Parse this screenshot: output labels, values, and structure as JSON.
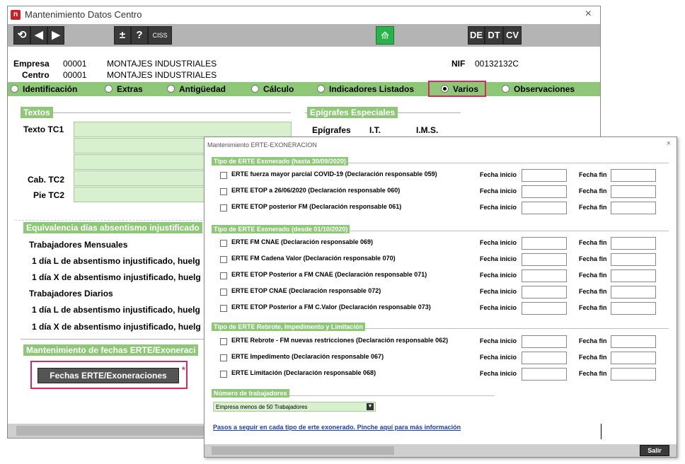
{
  "main_window": {
    "title": "Mantenimiento Datos Centro",
    "toolbar": {
      "refresh_glyph": "⟲",
      "prev_glyph": "◀",
      "next_glyph": "▶",
      "plusminus_label": "±",
      "help_label": "?",
      "ciss_label": "CISS",
      "cloud_glyph": "⟰",
      "de_label": "DE",
      "dt_label": "DT",
      "cv_label": "CV"
    },
    "empresa_label": "Empresa",
    "empresa_code": "00001",
    "empresa_name": "MONTAJES INDUSTRIALES",
    "centro_label": "Centro",
    "centro_code": "00001",
    "centro_name": "MONTAJES INDUSTRIALES",
    "nif_label": "NIF",
    "nif_value": "00132132C",
    "tabs": [
      "Identificación",
      "Extras",
      "Antigüedad",
      "Cálculo",
      "Indicadores Listados",
      "Varios",
      "Observaciones"
    ],
    "selected_tab": "Varios",
    "textos_title": "Textos",
    "texto_tc1_label": "Texto TC1",
    "cab_tc2_label": "Cab. TC2",
    "pie_tc2_label": "Pie TC2",
    "epigrafes_title": "Epígrafes Especiales",
    "epigrafes_label": "Epígrafes",
    "it_label": "I.T.",
    "ims_label": "I.M.S.",
    "equivalencia_title": "Equivalencia días absentismo injustificado",
    "trab_mensuales": "Trabajadores Mensuales",
    "mensual_l": "1 día L de absentismo injustificado, huelg",
    "mensual_x": "1 día X de absentismo injustificado, huelg",
    "trab_diarios": "Trabajadores Diarios",
    "diario_l": "1 día L de absentismo injustificado, huelg",
    "diario_x": "1 día X de absentismo injustificado, huelg",
    "erte_section_title": "Mantenimiento de fechas ERTE/Exoneraci",
    "fechas_button": "Fechas ERTE/Exoneraciones",
    "asterisk": "*"
  },
  "dialog": {
    "title": "Mantenimiento ERTE-EXONERACION",
    "close_glyph": "×",
    "fecha_inicio_label": "Fecha inicio",
    "fecha_fin_label": "Fecha fin",
    "sections": [
      {
        "title": "Tipo de ERTE Exonerado (hasta 30/09/2020)",
        "items": [
          "ERTE fuerza mayor parcial COVID-19 (Declaración responsable 059)",
          "ERTE ETOP a 26/06/2020 (Declaración responsable 060)",
          "ERTE ETOP posterior FM (Declaración responsable 061)"
        ]
      },
      {
        "title": "Tipo de ERTE Exonerado (desde 01/10/2020)",
        "items": [
          "ERTE FM CNAE (Declaración responsable 069)",
          "ERTE FM Cadena Valor (Declaración responsable 070)",
          "ERTE ETOP Posterior a FM CNAE (Declaración responsable 071)",
          "ERTE ETOP CNAE (Declaración responsable 072)",
          "ERTE ETOP Posterior a FM C.Valor (Declaración responsable 073)"
        ]
      },
      {
        "title": "Tipo de ERTE Rebrote, Impedimento y Limitación",
        "items": [
          "ERTE Rebrote - FM nuevas restricciones (Declaración responsable 062)",
          "ERTE Impedimento (Declaración responsable 067)",
          "ERTE Limitación (Declaración responsable 068)"
        ]
      }
    ],
    "num_trabajadores_title": "Número de trabajadores",
    "num_trabajadores_value": "Empresa menos de 50 Trabajadores",
    "info_link": "Pasos a seguir en cada tipo de erte exonerado. Pinche aquí para más información",
    "salir_label": "Salir"
  },
  "colors": {
    "accent_green": "#8fc779",
    "highlight_pink": "#d42a5e",
    "link_blue": "#1a3fa8"
  }
}
